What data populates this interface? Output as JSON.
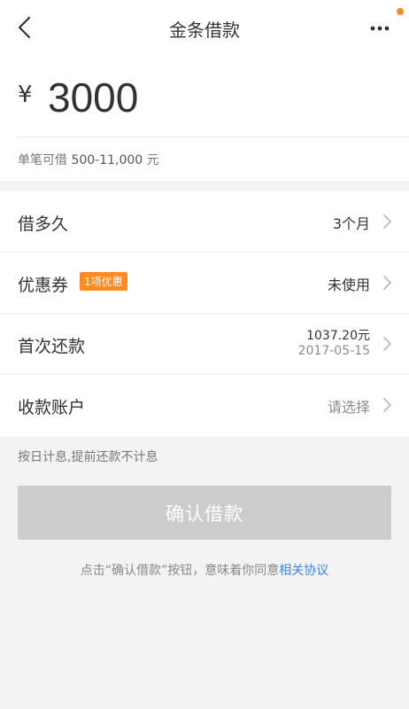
{
  "header": {
    "title": "金条借款"
  },
  "amount": {
    "currency_symbol": "¥",
    "value": "3000",
    "limit_prefix": "单笔可借",
    "limit_range": "500-11,000",
    "limit_suffix": "元"
  },
  "rows": {
    "duration": {
      "label": "借多久",
      "value": "3个月"
    },
    "coupon": {
      "label": "优惠券",
      "badge": "1项优惠",
      "value": "未使用"
    },
    "first_repayment": {
      "label": "首次还款",
      "amount": "1037.20元",
      "date": "2017-05-15"
    },
    "account": {
      "label": "收款账户",
      "value": "请选择"
    }
  },
  "interest_note": "按日计息,提前还款不计息",
  "confirm_button": "确认借款",
  "agreement": {
    "text": "点击“确认借款”按钮，意味着你同意",
    "link": "相关协议"
  },
  "colors": {
    "accent_orange": "#ff8a1f",
    "link_blue": "#3a86e0",
    "disabled_button": "#cccccc"
  },
  "icons": [
    "back-arrow-icon",
    "more-dots-icon",
    "chevron-right-icon"
  ]
}
